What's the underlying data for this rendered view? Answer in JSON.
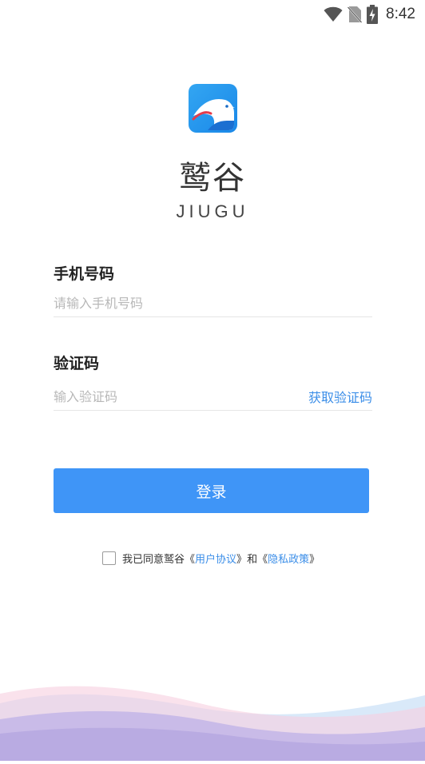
{
  "status_bar": {
    "time": "8:42",
    "icons": [
      "wifi-icon",
      "no-sim-icon",
      "battery-charging-icon"
    ]
  },
  "brand": {
    "name": "鹫谷",
    "subtitle": "JIUGU",
    "logo_icon": "eagle-logo-icon"
  },
  "form": {
    "phone_label": "手机号码",
    "phone_placeholder": "请输入手机号码",
    "code_label": "验证码",
    "code_placeholder": "输入验证码",
    "get_code_label": "获取验证码"
  },
  "login_button": "登录",
  "agreement": {
    "prefix": "我已同意鹫谷",
    "open_bracket": "《",
    "close_bracket": "》",
    "user_agreement": "用户协议",
    "and": "和",
    "privacy_policy": "隐私政策"
  },
  "colors": {
    "accent": "#3f95f7",
    "link": "#3b8ee8",
    "placeholder": "#b8b8b8"
  }
}
